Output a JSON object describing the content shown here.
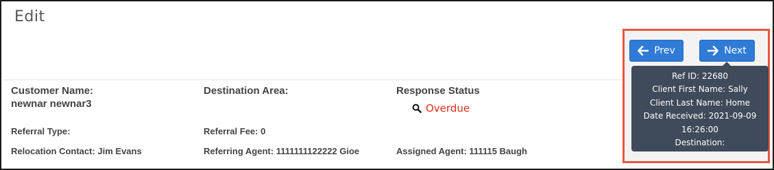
{
  "page": {
    "title": "Edit"
  },
  "details": {
    "customer_name_label": "Customer Name:",
    "customer_name_value": "newnar newnar3",
    "destination_area_label": "Destination Area:",
    "response_status_label": "Response Status",
    "response_status_value": "Overdue",
    "referral_type_label": "Referral Type:",
    "referral_fee_label": "Referral Fee: 0",
    "relocation_contact": "Relocation Contact: Jim Evans",
    "referring_agent": "Referring Agent: 1111111122222 Gioe",
    "assigned_agent": "Assigned Agent: 111115 Baugh"
  },
  "nav": {
    "prev_label": "Prev",
    "next_label": "Next"
  },
  "tooltip": {
    "lines": [
      "Ref ID: 22680",
      "Client First Name: Sally",
      "Client Last Name: Home",
      "Date Received: 2021-09-09",
      "16:26:00",
      "Destination:"
    ]
  },
  "colors": {
    "accent": "#2f7bd6",
    "status_overdue": "#e02d1b",
    "highlight": "#e8563f",
    "tooltip_bg": "#3f4a5a"
  },
  "icons": {
    "prev": "arrow-left-icon",
    "next": "arrow-right-icon",
    "status": "search-icon"
  }
}
